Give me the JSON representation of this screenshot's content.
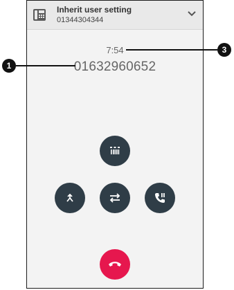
{
  "header": {
    "title": "Inherit user setting",
    "subtitle": "01344304344",
    "icon": "desk-phone-icon",
    "dropdown_icon": "chevron-down-icon"
  },
  "call": {
    "duration": "7:54",
    "remote_number": "01632960652"
  },
  "buttons": {
    "keypad": "dialpad-icon",
    "merge": "merge-call-icon",
    "transfer": "transfer-icon",
    "hold": "phone-hold-icon",
    "hangup": "hang-up-icon"
  },
  "colors": {
    "button_dark": "#2f3d47",
    "hangup_red": "#e6174e",
    "background": "#f3f3f3",
    "header_bg": "#e9e9e9"
  },
  "annotations": {
    "callout_1": "1",
    "callout_3": "3"
  }
}
